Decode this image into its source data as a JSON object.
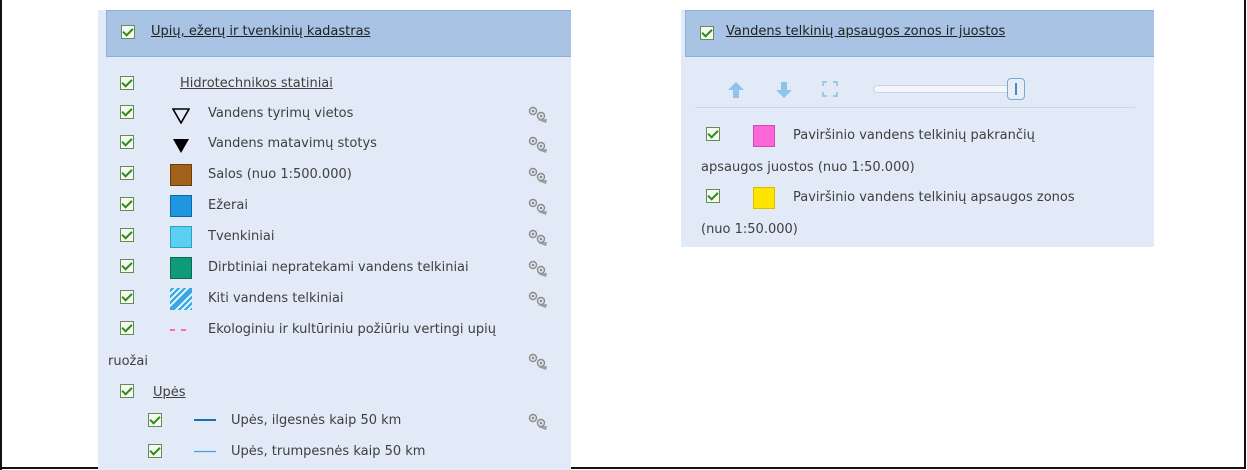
{
  "left_panel": {
    "header": {
      "title": "Upių, ežerų ir tvenkinių kadastras"
    },
    "rows": [
      {
        "label": "Hidrotechnikos statiniai",
        "link": true
      },
      {
        "label": "Vandens tyrimų vietos"
      },
      {
        "label": "Vandens matavimų stotys"
      },
      {
        "label": "Salos (nuo 1:500.000)"
      },
      {
        "label": "Ežerai"
      },
      {
        "label": "Tvenkiniai"
      },
      {
        "label": "Dirbtiniai nepratekami vandens telkiniai"
      },
      {
        "label": "Kiti vandens telkiniai"
      },
      {
        "label": "Ekologiniu ir kultūriniu požiūriu vertingi upių",
        "label_cont": "ruožai"
      },
      {
        "label": "Upės",
        "link": true
      },
      {
        "label": "Upės, ilgesnės kaip 50 km"
      },
      {
        "label": "Upės, trumpesnės kaip 50 km"
      }
    ],
    "colors": {
      "salos": "#a0621a",
      "ezerai": "#1e96e2",
      "tvenkiniai": "#5bcfef",
      "dirbtiniai": "#0f9b7a",
      "kiti": "#3aa6e6",
      "ekologiniai_line": "#ff66cc",
      "upes_long": "#1a6fb6",
      "upes_short": "#3aa6e6"
    }
  },
  "right_panel": {
    "header": {
      "title": "Vandens telkinių apsaugos zonos ir juostos"
    },
    "toolbar": {
      "up_icon": "arrow-up-icon",
      "down_icon": "arrow-down-icon",
      "expand_icon": "fullscreen-icon",
      "opacity": 0.95
    },
    "rows": [
      {
        "label": "Paviršinio vandens telkinių pakrančių",
        "label_cont": "apsaugos juostos (nuo 1:50.000)",
        "color": "#ff66d8"
      },
      {
        "label": "Paviršinio vandens telkinių apsaugos zonos",
        "label_cont": "(nuo 1:50.000)",
        "color": "#ffe400"
      }
    ]
  }
}
